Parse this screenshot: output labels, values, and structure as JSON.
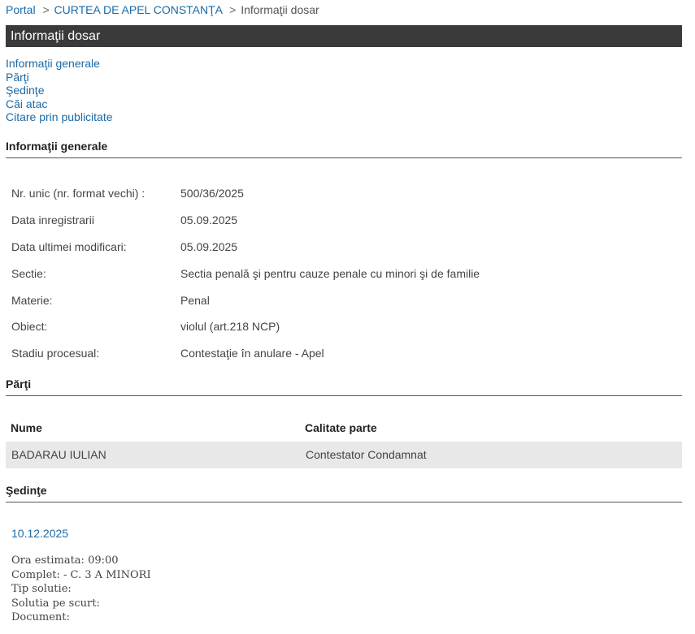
{
  "breadcrumb": {
    "portal": "Portal",
    "separator": ">",
    "court": "CURTEA DE APEL CONSTANŢA",
    "current": "Informaţii dosar"
  },
  "page_title": "Informaţii dosar",
  "anchor_nav": [
    "Informaţii generale",
    "Părţi",
    "Şedinţe",
    "Căi atac",
    "Citare prin publicitate"
  ],
  "general": {
    "heading": "Informaţii generale",
    "rows": [
      {
        "label": "Nr. unic (nr. format vechi) :",
        "value": "500/36/2025"
      },
      {
        "label": "Data inregistrarii",
        "value": "05.09.2025"
      },
      {
        "label": "Data ultimei modificari:",
        "value": "05.09.2025"
      },
      {
        "label": "Sectie:",
        "value": "Sectia penală şi pentru cauze penale cu minori şi de familie"
      },
      {
        "label": "Materie:",
        "value": "Penal"
      },
      {
        "label": "Obiect:",
        "value": "violul (art.218 NCP)"
      },
      {
        "label": "Stadiu procesual:",
        "value": "Contestaţie în anulare - Apel"
      }
    ]
  },
  "parti": {
    "heading": "Părţi",
    "columns": [
      "Nume",
      "Calitate parte"
    ],
    "rows": [
      {
        "nume": "BADARAU IULIAN",
        "calitate": "Contestator Condamnat"
      }
    ]
  },
  "sedinte": {
    "heading": "Şedinţe",
    "date": "10.12.2025",
    "details": [
      "Ora estimata: 09:00",
      "Complet: - C. 3 A MINORI",
      "Tip solutie:",
      "Solutia pe scurt:",
      "Document:"
    ]
  }
}
